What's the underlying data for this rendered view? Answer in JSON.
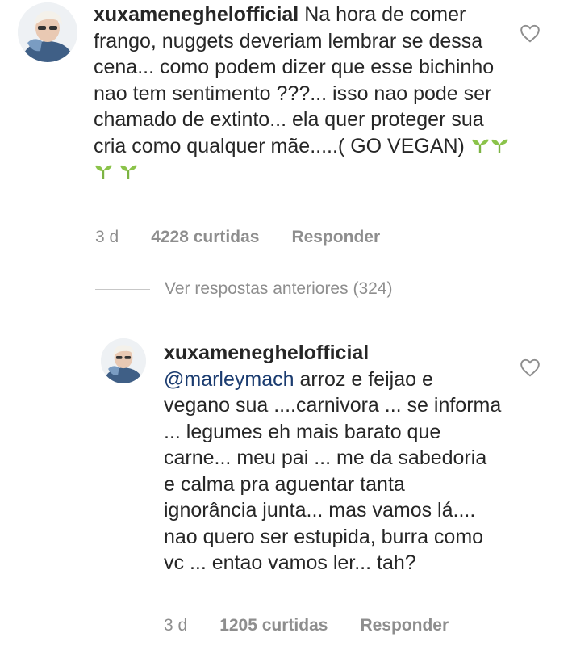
{
  "comment": {
    "username": "xuxameneghelofficial",
    "text": "Na hora de comer frango, nuggets deveriam lembrar se dessa cena... como podem dizer que esse bichinho nao tem sentimento ???... isso nao pode ser chamado de extinto... ela quer proteger sua cria como qualquer mãe.....( GO VEGAN)",
    "emoji_icons": [
      "seedling-icon",
      "seedling-icon",
      "seedling-icon",
      "seedling-icon"
    ],
    "time": "3 d",
    "likes": "4228 curtidas",
    "reply_label": "Responder"
  },
  "view_replies": {
    "label": "Ver respostas anteriores (324)"
  },
  "reply": {
    "username": "xuxameneghelofficial",
    "mention": "@marleymach",
    "text": "arroz e feijao e vegano sua ....carnivora ... se informa ... legumes eh mais barato que carne... meu pai ... me da sabedoria e calma pra aguentar tanta ignorância junta... mas vamos lá.... nao quero ser estupida, burra como  vc ... entao vamos ler... tah?",
    "time": "3 d",
    "likes": "1205 curtidas",
    "reply_label": "Responder"
  },
  "colors": {
    "text": "#262626",
    "meta": "#8e8e8e",
    "mention": "#1a3b6f",
    "emoji_green": "#7cb342"
  },
  "icons": {
    "like": "heart-outline-icon",
    "emoji": "seedling-icon"
  }
}
